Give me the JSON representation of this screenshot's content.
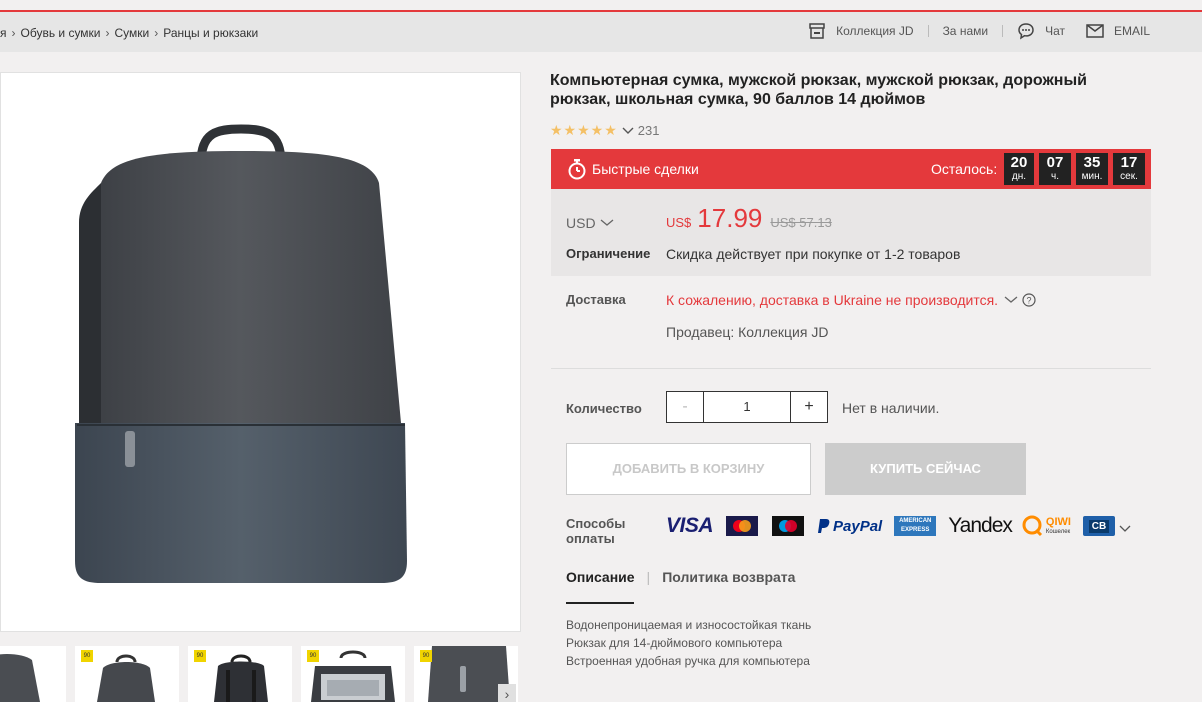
{
  "breadcrumb": {
    "items": [
      "я",
      "Обувь и сумки",
      "Сумки",
      "Ранцы и рюкзаки"
    ]
  },
  "header": {
    "links": [
      "Коллекция JD",
      "За нами",
      "Чат",
      "EMAIL"
    ]
  },
  "thumbnails": {
    "badge": "90",
    "next_arrow": "›"
  },
  "product": {
    "title": "Компьютерная сумка, мужской рюкзак, мужской рюкзак, дорожный рюкзак, школьная сумка, 90 баллов 14 дюймов",
    "stars": "★★★★★",
    "reviews": "231"
  },
  "deal": {
    "label": "Быстрые сделки",
    "remaining_label": "Осталось:",
    "timer": [
      {
        "num": "20",
        "unit": "дн."
      },
      {
        "num": "07",
        "unit": "ч."
      },
      {
        "num": "35",
        "unit": "мин."
      },
      {
        "num": "17",
        "unit": "сек."
      }
    ]
  },
  "price": {
    "currency_select": "USD",
    "currency": "US$",
    "value": "17.99",
    "old": "US$ 57.13",
    "limit_label": "Ограничение",
    "limit_text": "Скидка действует при покупке от 1-2 товаров"
  },
  "shipping": {
    "label": "Доставка",
    "message": "К сожалению, доставка в Ukraine  не производится.",
    "seller": "Продавец: Коллекция JD"
  },
  "quantity": {
    "label": "Количество",
    "minus": "-",
    "value": "1",
    "plus": "+",
    "stock": "Нет в наличии."
  },
  "buttons": {
    "add_to_cart": "ДОБАВИТЬ В КОРЗИНУ",
    "buy_now": "КУПИТЬ СЕЙЧАС"
  },
  "payment": {
    "label": "Способы оплаты",
    "methods": [
      "VISA",
      "MasterCard",
      "Maestro",
      "PayPal",
      "American Express",
      "Yandex",
      "QIWI",
      "CB"
    ],
    "visa": "VISA",
    "paypal": "PayPal",
    "amex": "AMERICAN EXPRESS",
    "yandex": "Yandex",
    "qiwi": "QIWI",
    "qiwi_sub": "Кошелек",
    "cb": "CB"
  },
  "tabs": {
    "description": "Описание",
    "separator": "|",
    "returns": "Политика возврата"
  },
  "description": {
    "lines": [
      "Водонепроницаемая и износостойкая ткань",
      "Рюкзак для 14-дюймового компьютера",
      "Встроенная удобная ручка для компьютера"
    ]
  },
  "colors": {
    "accent": "#e4393c",
    "stars": "#f4c066",
    "timer_bg": "#222222"
  }
}
